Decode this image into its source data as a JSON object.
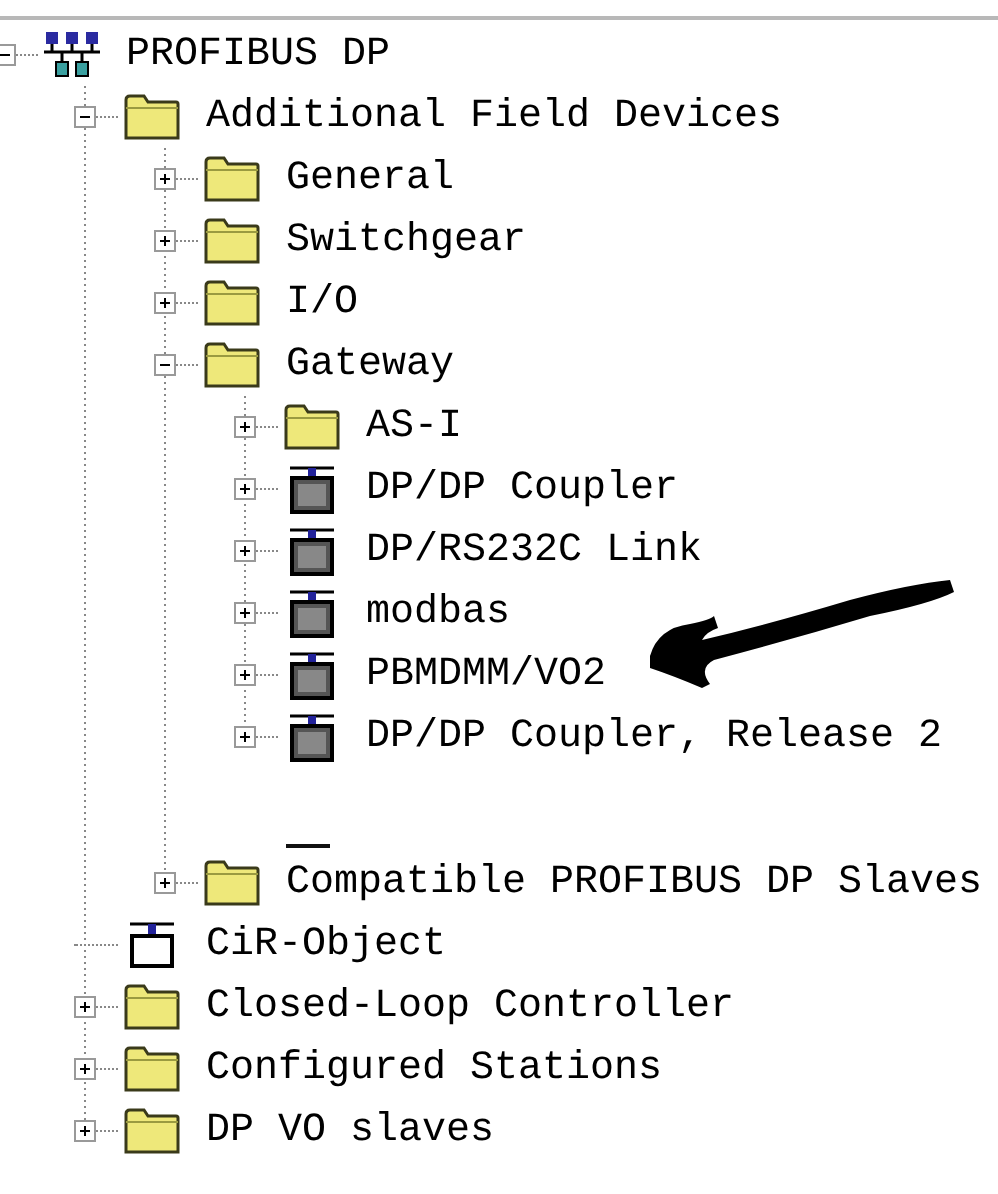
{
  "tree": {
    "nodes": [
      {
        "label": "PROFIBUS DP",
        "kind": "network",
        "leaf": false,
        "expanded": true,
        "children": [
          {
            "label": "Additional Field Devices",
            "kind": "folder",
            "leaf": false,
            "expanded": true,
            "children": [
              {
                "label": "General",
                "kind": "folder",
                "leaf": false,
                "expanded": false
              },
              {
                "label": "Switchgear",
                "kind": "folder",
                "leaf": false,
                "expanded": false
              },
              {
                "label": "I/O",
                "kind": "folder",
                "leaf": false,
                "expanded": false
              },
              {
                "label": "Gateway",
                "kind": "folder",
                "leaf": false,
                "expanded": true,
                "children": [
                  {
                    "label": "AS-I",
                    "kind": "folder",
                    "leaf": false,
                    "expanded": false
                  },
                  {
                    "label": "DP/DP Coupler",
                    "kind": "device",
                    "leaf": false,
                    "expanded": false
                  },
                  {
                    "label": "DP/RS232C Link",
                    "kind": "device",
                    "leaf": false,
                    "expanded": false
                  },
                  {
                    "label": "modbas",
                    "kind": "device",
                    "leaf": false,
                    "expanded": false
                  },
                  {
                    "label": "PBMDMM/VO2",
                    "kind": "device",
                    "leaf": false,
                    "expanded": false
                  },
                  {
                    "label": "DP/DP Coupler, Release 2",
                    "kind": "device",
                    "leaf": false,
                    "expanded": false
                  }
                ]
              },
              {
                "kind": "blank"
              },
              {
                "label": "Compatible PROFIBUS DP Slaves",
                "kind": "folder",
                "leaf": false,
                "expanded": false
              }
            ]
          },
          {
            "label": "CiR-Object",
            "kind": "cir",
            "leaf": true
          },
          {
            "label": "Closed-Loop Controller",
            "kind": "folder",
            "leaf": false,
            "expanded": false
          },
          {
            "label": "Configured Stations",
            "kind": "folder",
            "leaf": false,
            "expanded": false
          },
          {
            "label": "DP VO slaves",
            "kind": "folder",
            "leaf": false,
            "expanded": false
          }
        ]
      }
    ]
  },
  "annotation": {
    "kind": "arrow"
  }
}
